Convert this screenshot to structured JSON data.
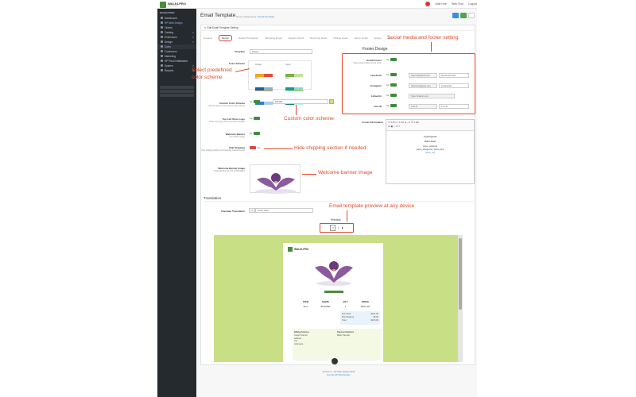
{
  "app": {
    "logo": "WALKLPRO",
    "logo_sub": "SOLUTIONS"
  },
  "header": {
    "user": "Jolie Hoe",
    "store": "Web Tech",
    "logout": "Logout"
  },
  "sidebar": {
    "title": "NAVIGATION",
    "items": [
      {
        "label": "Dashboard",
        "arrow": ""
      },
      {
        "label": "HP Web Design",
        "arrow": ""
      },
      {
        "label": "Orders",
        "arrow": ""
      },
      {
        "label": "Catalog",
        "arrow": ">"
      },
      {
        "label": "Extensions",
        "arrow": ">"
      },
      {
        "label": "Design",
        "arrow": ">"
      },
      {
        "label": "Sales",
        "arrow": ""
      },
      {
        "label": "Customers",
        "arrow": ""
      },
      {
        "label": "Marketing",
        "arrow": ""
      },
      {
        "label": "HP Push Notification",
        "arrow": ""
      },
      {
        "label": "System",
        "arrow": ">"
      },
      {
        "label": "Reports",
        "arrow": ">"
      }
    ]
  },
  "page": {
    "title": "Email Template",
    "breadcrumb": {
      "home": "Home",
      "mid": "Extensions",
      "current": "Email Template"
    },
    "card_title": "Edit Email Template Setting"
  },
  "tabs": [
    "General",
    "Design",
    "Default Translation",
    "Marketing Email",
    "Register Email",
    "Recurring Email",
    "Affiliate Email",
    "Admin Email",
    "Setting",
    "Help"
  ],
  "form": {
    "template_label": "Template",
    "template_value": "Default",
    "color_scheme_label": "Color Scheme",
    "scheme_names": [
      "Orange",
      "Green",
      "Blue",
      "Teal"
    ],
    "custom_color_label": "Custom Color Scheme",
    "custom_color_sub": "Use this option to use custom color scheme",
    "custom_color_value": "#c8df85",
    "top_left_label": "Top Left Store Logo",
    "top_left_sub": "Show store logo on top left of the template",
    "welcome_label": "Welcome Banner",
    "welcome_sub": "Use banner image",
    "hide_ship_label": "Hide Shipping",
    "hide_ship_sub": "Hide shipping address and shipping method section",
    "banner_img_label": "Welcome Banner Image",
    "banner_img_sub": "Preferable Banner size is 500x250px",
    "yes": "Yes",
    "no": "No"
  },
  "footer_design": {
    "title": "Footer Design",
    "social_label": "Social Footer",
    "social_sub": "Show social media icons at footer",
    "rows": [
      {
        "label": "Facebook",
        "url": "https://facebook.com",
        "handle": "facebookhandle"
      },
      {
        "label": "Instagram",
        "url": "https://instagram.com",
        "handle": "instahandle"
      },
      {
        "label": "Linked In",
        "url": "https://linkedin.com",
        "handle": ""
      },
      {
        "label": "Line ID",
        "url": "Line ID",
        "handle": "Line ID"
      }
    ],
    "footer_info_label": "Footer Information",
    "footer_text": [
      "Lorem Ipsum",
      "Dolor Amet",
      "[store_address]",
      "[store_telephone] / [store_fax]",
      "[store_url]"
    ]
  },
  "translation": {
    "title": "Translation",
    "label": "Translate Translation",
    "value": "Thank Order"
  },
  "preview": {
    "title": "Preview",
    "table_headers": [
      "ITEM",
      "NAME",
      "QTY",
      "PRICE"
    ],
    "table_row": [
      "Item",
      "iPHONE",
      "1",
      "$101.00"
    ],
    "totals": [
      [
        "Sub-Total",
        "$101.00"
      ],
      [
        "Flat Shipping",
        "$5.00"
      ],
      [
        "Total",
        "$106.00"
      ]
    ],
    "billing_label": "Billing Address",
    "billing_lines": [
      "Joseph Farrell",
      "address",
      "city",
      "Indonesia"
    ],
    "payment_label": "Payment Method",
    "payment_value": "Bank Transfer"
  },
  "annotations": {
    "social": "Social media and footer setting",
    "scheme": "Select predefined color scheme",
    "custom": "Custom color scheme",
    "hide": "Hide shipping section if needed",
    "banner": "Welcome banner image",
    "preview": "Email template preview at any device"
  },
  "footer": {
    "line1": "Version 3 - HP Web Design 2022",
    "line2": "Dev By HP Web Design"
  },
  "colors": {
    "accent": "#e04a2a",
    "sidebar": "#252a2f",
    "preview_bg": "#c8df85",
    "toggle_on": "#3c8c3c",
    "toggle_off": "#d44444"
  }
}
